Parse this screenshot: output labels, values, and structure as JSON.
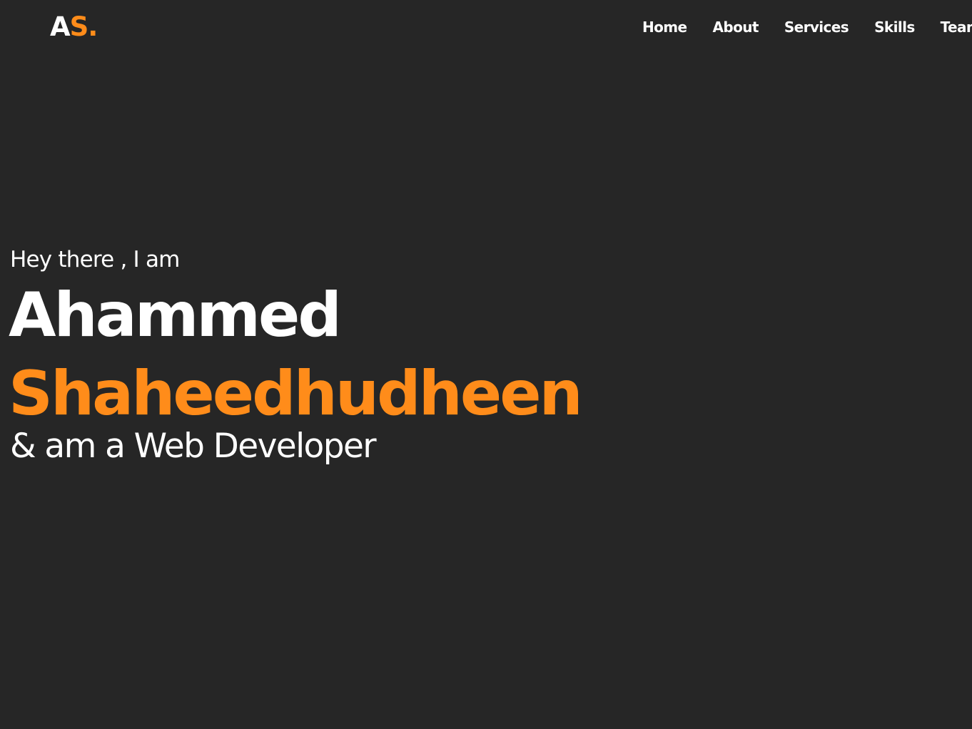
{
  "logo": {
    "letter_a": "A",
    "letter_s": "S.",
    "accent_color": "#ff8c1a"
  },
  "nav": {
    "items": [
      {
        "label": "Home"
      },
      {
        "label": "About"
      },
      {
        "label": "Services"
      },
      {
        "label": "Skills"
      },
      {
        "label": "Team"
      }
    ]
  },
  "hero": {
    "greeting": "Hey there , I am",
    "first_name": "Ahammed",
    "last_name": "Shaheedhudheen",
    "role": "& am a Web Developer"
  },
  "colors": {
    "background": "#262626",
    "text": "#ffffff",
    "accent": "#ff8c1a"
  }
}
